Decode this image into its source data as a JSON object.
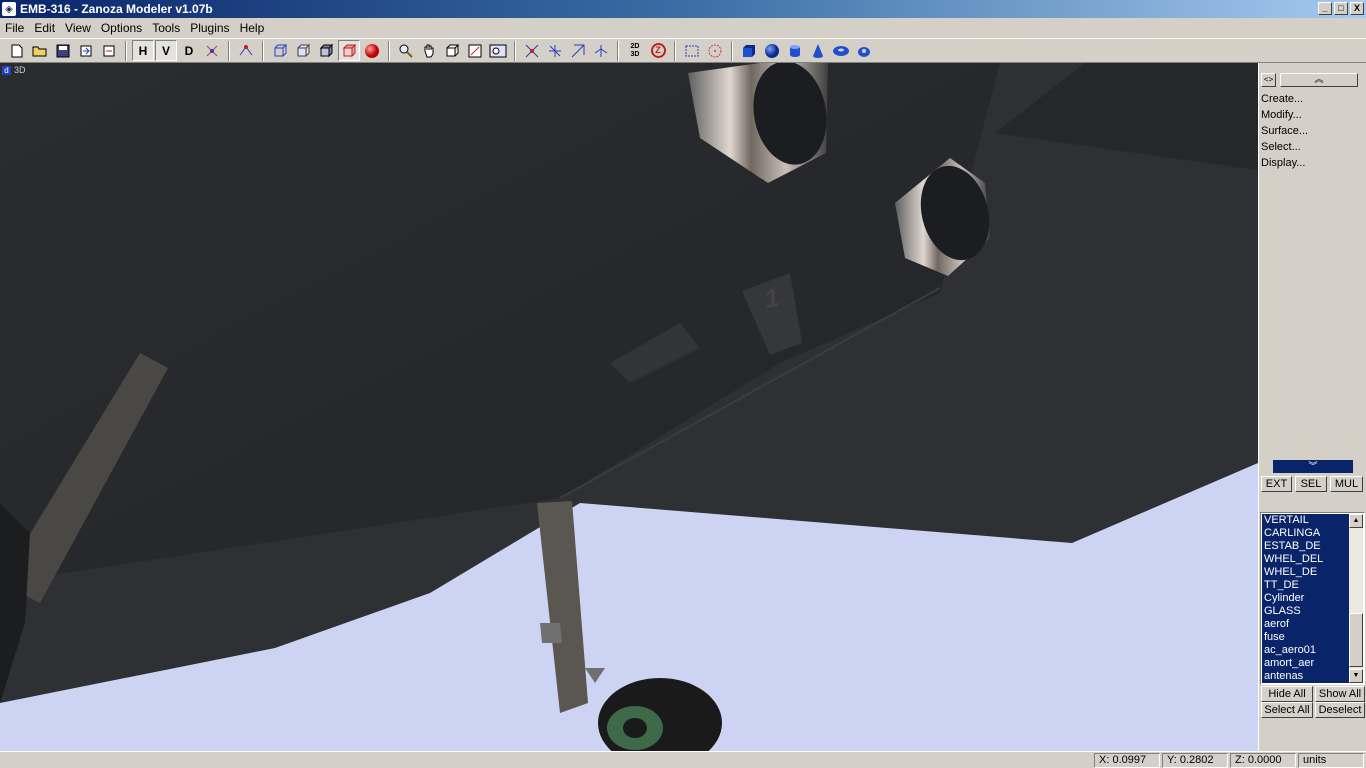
{
  "window": {
    "title": "EMB-316 - Zanoza Modeler v1.07b",
    "controls": [
      "_",
      "□",
      "X"
    ]
  },
  "menu": [
    "File",
    "Edit",
    "View",
    "Options",
    "Tools",
    "Plugins",
    "Help"
  ],
  "toolbar": {
    "h_label": "H",
    "v_label": "V",
    "d_label": "D",
    "view2d3d_label": "2D 3D",
    "z_label": "Z"
  },
  "viewport": {
    "view_label": "3D",
    "decal_number": "1"
  },
  "panel": {
    "collapse_glyph": "︽",
    "expand_glyph": "︾",
    "nav_glyph": "<>",
    "menu": [
      "Create...",
      "Modify...",
      "Surface...",
      "Select...",
      "Display..."
    ],
    "modes": [
      "EXT",
      "SEL",
      "MUL"
    ],
    "objects": [
      "VERTAIL",
      "CARLINGA",
      "ESTAB_DE",
      "WHEL_DEL",
      "WHEL_DE",
      "TT_DE",
      "Cylinder",
      "GLASS",
      "aerof",
      "fuse",
      "ac_aero01",
      "amort_aer",
      "antenas"
    ],
    "hide_all": "Hide All",
    "show_all": "Show All",
    "select_all": "Select All",
    "deselect": "Deselect"
  },
  "status": {
    "x": "X: 0.0997",
    "y": "Y: 0.2802",
    "z": "Z: 0.0000",
    "units": "units"
  },
  "colors": {
    "sky": "#cdd3f2",
    "fuselage": "#2b2d30",
    "selection": "#0a246a"
  }
}
